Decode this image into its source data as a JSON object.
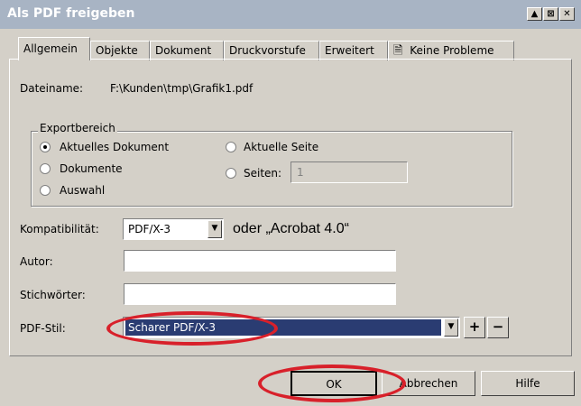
{
  "window": {
    "title": "Als PDF freigeben"
  },
  "tabs": [
    {
      "label": "Allgemein"
    },
    {
      "label": "Objekte"
    },
    {
      "label": "Dokument"
    },
    {
      "label": "Druckvorstufe"
    },
    {
      "label": "Erweitert"
    },
    {
      "label": "Keine Probleme"
    }
  ],
  "filename": {
    "label": "Dateiname:",
    "value": "F:\\Kunden\\tmp\\Grafik1.pdf"
  },
  "export_range": {
    "legend": "Exportbereich",
    "current_document": "Aktuelles Dokument",
    "documents": "Dokumente",
    "selection": "Auswahl",
    "current_page": "Aktuelle Seite",
    "pages": "Seiten:",
    "pages_value": "1"
  },
  "compatibility": {
    "label": "Kompatibilität:",
    "value": "PDF/X-3",
    "note": "oder „Acrobat 4.0“"
  },
  "author": {
    "label": "Autor:",
    "value": ""
  },
  "keywords": {
    "label": "Stichwörter:",
    "value": ""
  },
  "pdf_style": {
    "label": "PDF-Stil:",
    "value": "Scharer PDF/X-3",
    "add": "+",
    "remove": "−"
  },
  "buttons": {
    "ok": "OK",
    "cancel": "Abbrechen",
    "help": "Hilfe"
  }
}
